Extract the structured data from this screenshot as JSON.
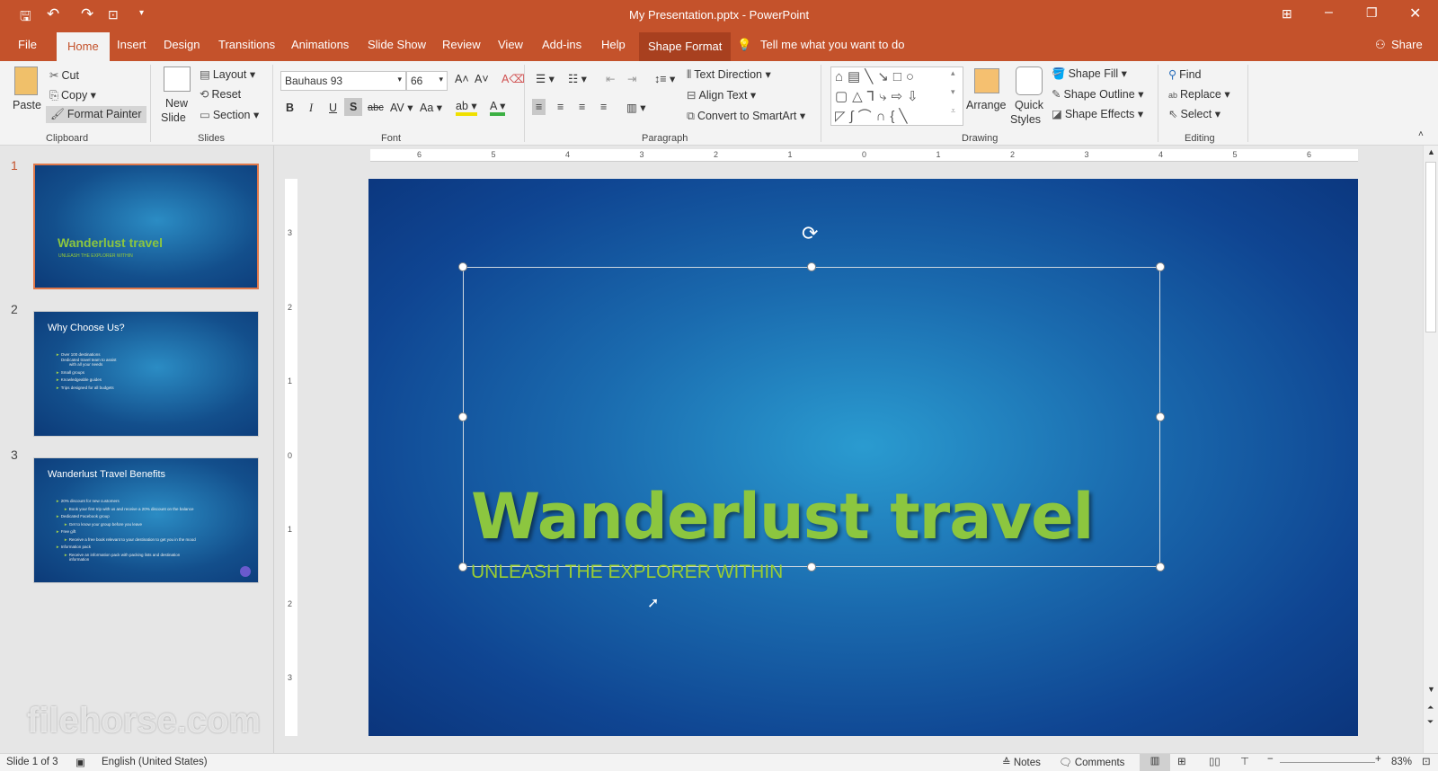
{
  "window": {
    "title": "My Presentation.pptx  -  PowerPoint"
  },
  "qat": {
    "save": "save-icon",
    "undo": "undo-icon",
    "redo": "redo-icon",
    "present": "present-icon"
  },
  "tabs": [
    "File",
    "Home",
    "Insert",
    "Design",
    "Transitions",
    "Animations",
    "Slide Show",
    "Review",
    "View",
    "Add-ins",
    "Help",
    "Shape Format"
  ],
  "tell_me": "Tell me what you want to do",
  "share": "Share",
  "ribbon": {
    "clipboard": {
      "paste": "Paste",
      "cut": "Cut",
      "copy": "Copy",
      "format_painter": "Format Painter",
      "label": "Clipboard"
    },
    "slides": {
      "new_slide_1": "New",
      "new_slide_2": "Slide",
      "layout": "Layout",
      "reset": "Reset",
      "section": "Section",
      "label": "Slides"
    },
    "font": {
      "name": "Bauhaus 93",
      "size": "66",
      "label": "Font",
      "bold": "B",
      "italic": "I",
      "underline": "U",
      "shadow": "S",
      "strike": "abc",
      "spacing": "AV",
      "case": "Aa"
    },
    "paragraph": {
      "text_direction": "Text Direction",
      "align_text": "Align Text",
      "convert": "Convert to SmartArt",
      "label": "Paragraph"
    },
    "drawing": {
      "arrange": "Arrange",
      "quick_1": "Quick",
      "quick_2": "Styles",
      "fill": "Shape Fill",
      "outline": "Shape Outline",
      "effects": "Shape Effects",
      "label": "Drawing"
    },
    "editing": {
      "find": "Find",
      "replace": "Replace",
      "select": "Select",
      "label": "Editing"
    }
  },
  "ruler": {
    "h": [
      "6",
      "5",
      "4",
      "3",
      "2",
      "1",
      "0",
      "1",
      "2",
      "3",
      "4",
      "5",
      "6"
    ],
    "v": [
      "3",
      "2",
      "1",
      "0",
      "1",
      "2",
      "3"
    ]
  },
  "thumbnails": [
    {
      "num": "1",
      "title": "Wanderlust travel",
      "subtitle": "UNLEASH THE EXPLORER WITHIN"
    },
    {
      "num": "2",
      "title": "Why Choose Us?",
      "bullets": [
        "Over 100 destinations",
        "Dedicated travel team to assist",
        "with all your needs",
        "Small groups",
        "Knowledgeable guides",
        "Trips designed for all budgets"
      ]
    },
    {
      "num": "3",
      "title": "Wanderlust Travel Benefits",
      "bullets": [
        "20% discount for new customers",
        "Book your first trip with us and receive a 20% discount on the balance",
        "Dedicated Facebook group",
        "Get to know your group before you leave",
        "Free gift",
        "Receive a free book relevant to your destination to get you in the mood",
        "Information pack",
        "Receive an information pack with packing lists and destination",
        "information"
      ]
    }
  ],
  "slide": {
    "title": "Wanderlust travel",
    "subtitle": "UNLEASH THE EXPLORER WITHIN"
  },
  "status": {
    "slide": "Slide 1 of 3",
    "language": "English (United States)",
    "notes": "Notes",
    "comments": "Comments",
    "zoom": "83%"
  },
  "watermark": "filehorse.com"
}
